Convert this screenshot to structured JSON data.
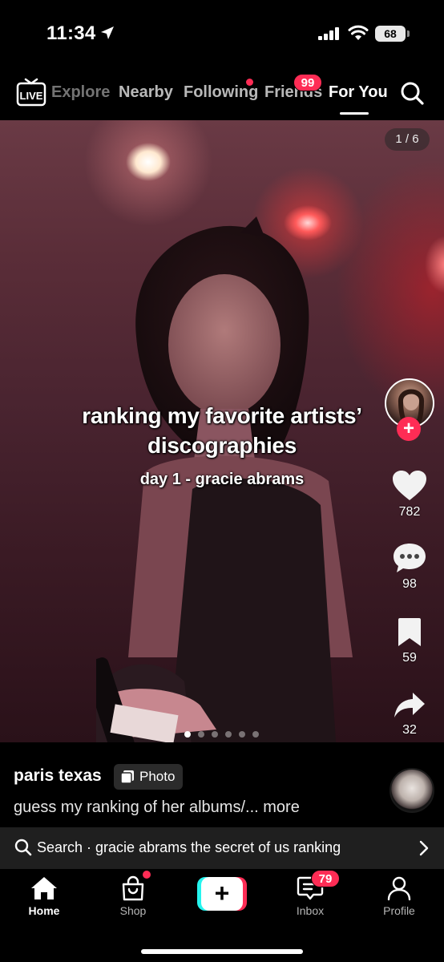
{
  "status_bar": {
    "time": "11:34",
    "battery": "68",
    "icons": [
      "location-arrow-icon",
      "signal-icon",
      "wifi-icon",
      "battery-icon"
    ]
  },
  "top_nav": {
    "live_label": "LIVE",
    "tabs": [
      {
        "label": "Explore"
      },
      {
        "label": "Nearby"
      },
      {
        "label": "Following"
      },
      {
        "label": "Friends"
      },
      {
        "label": "For You"
      }
    ],
    "active_tab": "For You",
    "friends_badge": "99",
    "accent": "#fe2c55"
  },
  "post": {
    "page_indicator": "1 / 6",
    "overlay_title_lines": [
      "ranking my favorite artists’",
      "discographies"
    ],
    "overlay_subtitle": "day 1 - gracie abrams",
    "likes": "782",
    "comments": "98",
    "saves": "59",
    "shares": "32",
    "follow_symbol": "+",
    "carousel_total": 6,
    "carousel_active_index": 0
  },
  "info": {
    "username": "paris texas",
    "type_badge": "Photo",
    "description": "guess my ranking of her albums/... more"
  },
  "search_strip": {
    "text": "Search · gracie abrams the secret of us ranking"
  },
  "bottom_nav": {
    "home": "Home",
    "shop": "Shop",
    "create_symbol": "+",
    "inbox": "Inbox",
    "profile": "Profile",
    "inbox_badge": "79",
    "active": "Home"
  }
}
